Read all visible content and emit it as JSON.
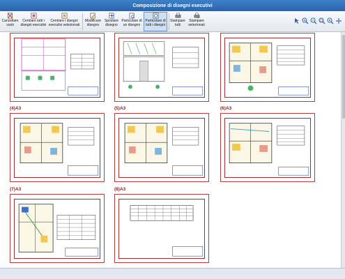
{
  "window": {
    "title": "Composizione di disegni esecutivi"
  },
  "toolbar": {
    "buttons": [
      {
        "id": "cancel",
        "label": "Cancellare\nvuoti",
        "icon": "delete-empty-icon",
        "active": false
      },
      {
        "id": "center_all",
        "label": "Centrare tutti i\ndisegni esecutivi",
        "icon": "center-all-icon",
        "active": false
      },
      {
        "id": "center_selected",
        "label": "Centrare i disegni\nesecutivi selezionati",
        "icon": "center-selected-icon",
        "active": false
      },
      {
        "id": "modify",
        "label": "Modificare\ndisegno",
        "icon": "edit-drawing-icon",
        "active": false
      },
      {
        "id": "move",
        "label": "Spostare\ndisegno",
        "icon": "move-drawing-icon",
        "active": false
      },
      {
        "id": "detail_one",
        "label": "Particolare di\nun disegno",
        "icon": "detail-one-icon",
        "active": false
      },
      {
        "id": "detail_all",
        "label": "Particolare di\ntutti i disegni",
        "icon": "detail-all-icon",
        "active": true
      },
      {
        "id": "print_all",
        "label": "Stampare\ntutti",
        "icon": "printer-icon",
        "active": false
      },
      {
        "id": "print_selected",
        "label": "Stampare\nselezionati",
        "icon": "printer-selected-icon",
        "active": false
      }
    ],
    "zoom_icons": [
      "pointer-icon",
      "zoom-in-icon",
      "zoom-out-icon",
      "zoom-window-icon",
      "zoom-all-icon",
      "pan-icon"
    ]
  },
  "sheets": [
    {
      "label": "",
      "kind": "site"
    },
    {
      "label": "",
      "kind": "elevation"
    },
    {
      "label": "",
      "kind": "plan-color"
    },
    {
      "label": "(4)A3",
      "kind": "plan-table"
    },
    {
      "label": "(5)A3",
      "kind": "plan-table"
    },
    {
      "label": "(6)A3",
      "kind": "plan-color"
    },
    {
      "label": "(7)A3",
      "kind": "plan-detail"
    },
    {
      "label": "(8)A3",
      "kind": "table"
    }
  ],
  "colors": {
    "sheet_border": "#b83a3a",
    "label": "#8b1c1c",
    "titlebar": "#2f6fb9"
  }
}
